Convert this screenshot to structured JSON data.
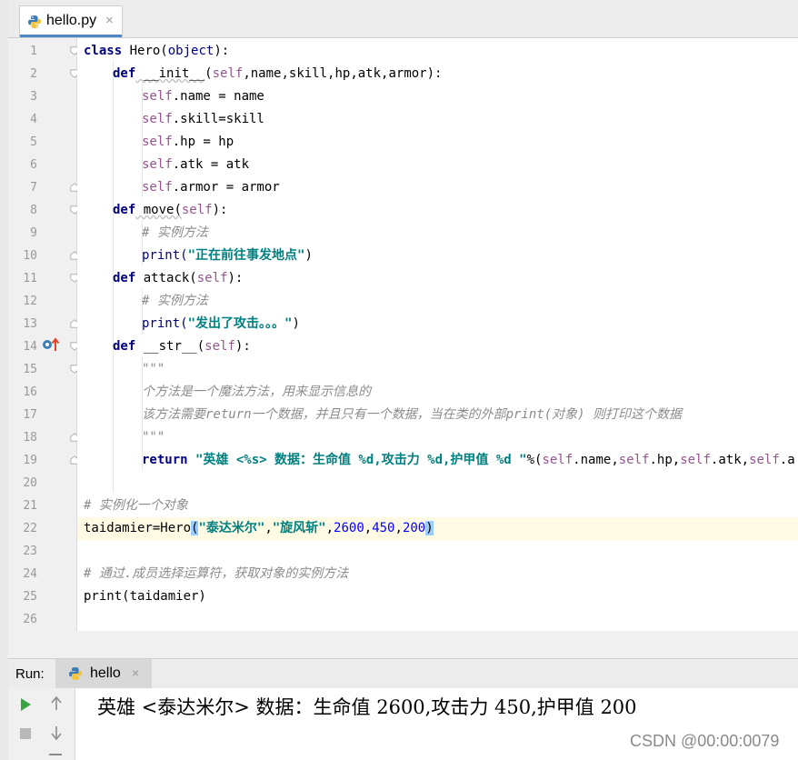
{
  "editor_tab": {
    "filename": "hello.py",
    "close": "×"
  },
  "line_numbers": [
    "1",
    "2",
    "3",
    "4",
    "5",
    "6",
    "7",
    "8",
    "9",
    "10",
    "11",
    "12",
    "13",
    "14",
    "15",
    "16",
    "17",
    "18",
    "19",
    "20",
    "21",
    "22",
    "23",
    "24",
    "25",
    "26"
  ],
  "code": {
    "l1_kw": "class",
    "l1_rest": " Hero(",
    "l1_obj": "object",
    "l1_end": "):",
    "l2_kw": "def",
    "l2_name": " __init__",
    "l2_open": "(",
    "l2_self": "self",
    "l2_rest": ",name,skill,hp,atk,armor):",
    "l3_self": "self",
    "l3_rest": ".name = name",
    "l4_self": "self",
    "l4_rest": ".skill=skill",
    "l5_self": "self",
    "l5_rest": ".hp = hp",
    "l6_self": "self",
    "l6_rest": ".atk = atk",
    "l7_self": "self",
    "l7_rest": ".armor = armor",
    "l8_kw": "def",
    "l8_name": " move(",
    "l8_self": "self",
    "l8_end": "):",
    "l9_cmt": "# 实例方法",
    "l10_fn": "print(",
    "l10_str": "\"正在前往事发地点\"",
    "l10_end": ")",
    "l11_kw": "def",
    "l11_name": " attack(",
    "l11_self": "self",
    "l11_end": "):",
    "l12_cmt": "# 实例方法",
    "l13_fn": "print(",
    "l13_str": "\"发出了攻击。。。\"",
    "l13_end": ")",
    "l14_kw": "def",
    "l14_name": " __str__",
    "l14_open": "(",
    "l14_self": "self",
    "l14_end": "):",
    "l15_doc": "\"\"\"",
    "l16_doc": "个方法是一个魔法方法，用来显示信息的",
    "l17_doc": "该方法需要return一个数据，并且只有一个数据，当在类的外部print(对象) 则打印这个数据",
    "l18_doc": "\"\"\"",
    "l19_kw": "return",
    "l19_str": " \"英雄 <%s> 数据：生命值 %d,攻击力 %d,护甲值 %d \"",
    "l19_rest1": "%(",
    "l19_s1": "self",
    "l19_r1": ".name,",
    "l19_s2": "self",
    "l19_r2": ".hp,",
    "l19_s3": "self",
    "l19_r3": ".atk,",
    "l19_s4": "self",
    "l19_r4": ".a",
    "l21_cmt": "# 实例化一个对象",
    "l22_a": "taidamier=Hero",
    "l22_open": "(",
    "l22_s1": "\"泰达米尔\"",
    "l22_c1": ",",
    "l22_s2": "\"旋风斩\"",
    "l22_c2": ",",
    "l22_n1": "2600",
    "l22_c3": ",",
    "l22_n2": "450",
    "l22_c4": ",",
    "l22_n3": "200",
    "l22_close": ")",
    "l24_cmt": "# 通过.成员选择运算符，获取对象的实例方法",
    "l25": "print(taidamier)"
  },
  "run_panel": {
    "label": "Run:",
    "tab_label": "hello",
    "tab_close": "×",
    "output": "英雄 <泰达米尔> 数据：生命值 2600,攻击力 450,护甲值 200"
  },
  "watermark": "CSDN @00:00:0079",
  "colors": {
    "keyword": "#000080",
    "string": "#008080",
    "number": "#0000ff",
    "self": "#94558d",
    "comment": "#8c8c8c",
    "current_line": "#fffae3",
    "run_green": "#3aa344"
  }
}
